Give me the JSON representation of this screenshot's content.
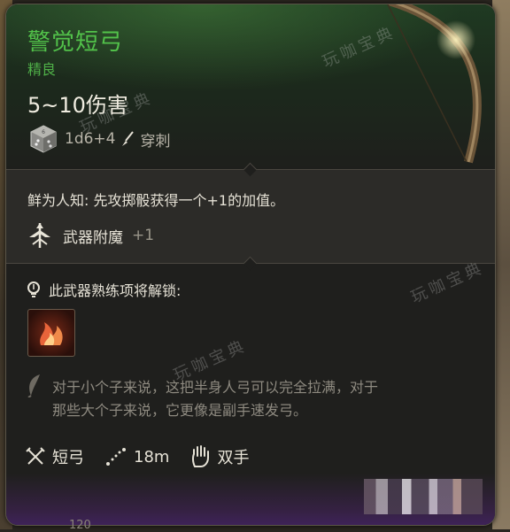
{
  "item": {
    "name": "警觉短弓",
    "rarity": "精良",
    "damage": "5~10伤害",
    "dice": "1d6+4",
    "damage_type": "穿刺"
  },
  "properties": {
    "rare_text": "鲜为人知: 先攻掷骰获得一个+1的加值。",
    "enchant_label": "武器附魔",
    "enchant_bonus": "+1"
  },
  "proficiency": {
    "label": "此武器熟练项将解锁:"
  },
  "description": {
    "line1": "对于小个子来说，这把半身人弓可以完全拉满，对于",
    "line2": "那些大个子来说，它更像是副手速发弓。"
  },
  "stats": {
    "weapon_type": "短弓",
    "range": "18m",
    "handedness": "双手"
  },
  "watermark": "玩咖宝典",
  "bottom_number": "120",
  "colors": {
    "name_green": "#52c24a",
    "rarity_green": "#4fb048",
    "text_light": "#e6e2d6",
    "text_muted": "#8e8a80",
    "footer_purple": "#3e2258"
  },
  "icons": {
    "dice": "d6-dice-icon",
    "damage_type": "piercing-icon",
    "enchant": "weapon-enchant-icon",
    "proficiency": "lightbulb-icon",
    "skill": "flame-action-icon",
    "description": "feather-icon",
    "weapon_type": "crossed-arrows-icon",
    "range": "range-dots-icon",
    "handedness": "hand-icon"
  }
}
